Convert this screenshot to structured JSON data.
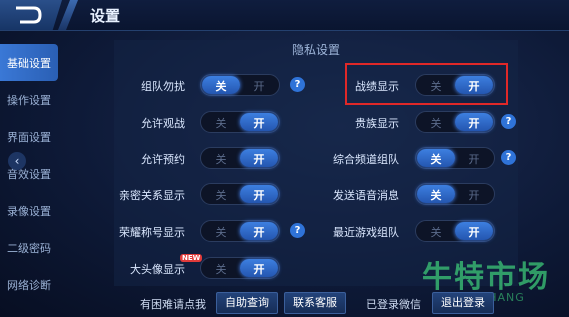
{
  "header": {
    "title": "设置"
  },
  "sidebar": {
    "items": [
      {
        "label": "基础设置",
        "active": true
      },
      {
        "label": "操作设置"
      },
      {
        "label": "界面设置"
      },
      {
        "label": "音效设置"
      },
      {
        "label": "录像设置"
      },
      {
        "label": "二级密码"
      },
      {
        "label": "网络诊断"
      }
    ],
    "collapse_icon": "chevron-left-icon"
  },
  "section": {
    "title": "隐私设置"
  },
  "toggle_text": {
    "off": "关",
    "on": "开"
  },
  "settings": {
    "team_dnd": {
      "label": "组队勿扰",
      "state": "关"
    },
    "allow_spectate": {
      "label": "允许观战",
      "state": "开"
    },
    "allow_reservation": {
      "label": "允许预约",
      "state": "开"
    },
    "intimate_display": {
      "label": "亲密关系显示",
      "state": "开"
    },
    "honor_title": {
      "label": "荣耀称号显示",
      "state": "开"
    },
    "avatar_display": {
      "label": "大头像显示",
      "state": "开",
      "badge": "NEW"
    },
    "record_display": {
      "label": "战绩显示",
      "state": "开"
    },
    "noble_display": {
      "label": "贵族显示",
      "state": "开"
    },
    "channel_team": {
      "label": "综合频道组队",
      "state": "关"
    },
    "voice_message": {
      "label": "发送语音消息",
      "state": "关"
    },
    "recent_team": {
      "label": "最近游戏组队",
      "state": "开"
    }
  },
  "help_icon": "?",
  "footer": {
    "help_prompt": "有困难请点我",
    "self_help": "自助查询",
    "contact": "联系客服",
    "wechat_status": "已登录微信",
    "logout": "退出登录"
  },
  "watermark": {
    "main": "牛特市场",
    "sub": "HICHANG"
  },
  "colors": {
    "accent": "#2f73d8",
    "highlight": "#e02828",
    "watermark": "#3cc878"
  }
}
